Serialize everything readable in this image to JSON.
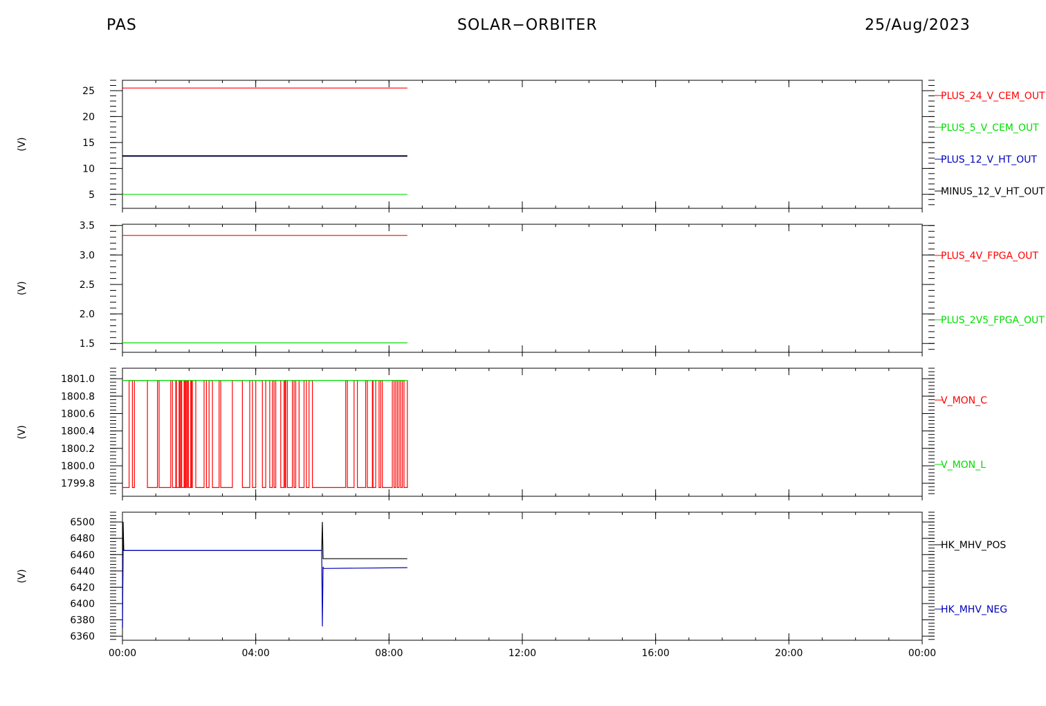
{
  "header": {
    "left": "PAS",
    "center": "SOLAR−ORBITER",
    "right": "25/Aug/2023"
  },
  "colors": {
    "red": "#ff0000",
    "green": "#00dd00",
    "blue": "#0000bb",
    "black": "#000000"
  },
  "chart_data": [
    {
      "type": "line",
      "ylabel": "(V)",
      "ylim": [
        2.3,
        27.0
      ],
      "yticks": [
        5,
        10,
        15,
        20,
        25
      ],
      "yticklabels": [
        "5",
        "10",
        "15",
        "20",
        "25"
      ],
      "xlim": [
        0,
        24
      ],
      "series": [
        {
          "name": "PLUS_24_V_CEM_OUT",
          "color": "red",
          "x": [
            0,
            8.55
          ],
          "y": [
            25.5,
            25.5
          ]
        },
        {
          "name": "PLUS_5_V_CEM_OUT",
          "color": "green",
          "x": [
            0,
            8.55
          ],
          "y": [
            5.0,
            5.0
          ]
        },
        {
          "name": "PLUS_12_V_HT_OUT",
          "color": "blue",
          "x": [
            0,
            8.55
          ],
          "y": [
            12.4,
            12.4
          ]
        },
        {
          "name": "MINUS_12_V_HT_OUT",
          "color": "black",
          "x": [
            0,
            8.55
          ],
          "y": [
            12.4,
            12.4
          ]
        }
      ]
    },
    {
      "type": "line",
      "ylabel": "(V)",
      "ylim": [
        1.35,
        3.52
      ],
      "yticks": [
        1.5,
        2.0,
        2.5,
        3.0,
        3.5
      ],
      "yticklabels": [
        "1.5",
        "2.0",
        "2.5",
        "3.0",
        "3.5"
      ],
      "xlim": [
        0,
        24
      ],
      "series": [
        {
          "name": "PLUS_4V_FPGA_OUT",
          "color": "red",
          "x": [
            0,
            8.55
          ],
          "y": [
            3.33,
            3.33
          ]
        },
        {
          "name": "PLUS_2V5_FPGA_OUT",
          "color": "green",
          "x": [
            0,
            8.55
          ],
          "y": [
            1.51,
            1.51
          ]
        }
      ]
    },
    {
      "type": "line",
      "ylabel": "(V)",
      "ylim": [
        1799.65,
        1801.12
      ],
      "yticks": [
        1799.8,
        1800.0,
        1800.2,
        1800.4,
        1800.6,
        1800.8,
        1801.0
      ],
      "yticklabels": [
        "1799.8",
        "1800.0",
        "1800.2",
        "1800.4",
        "1800.6",
        "1800.8",
        "1801.0"
      ],
      "xlim": [
        0,
        24
      ],
      "series": [
        {
          "name": "V_MON_C",
          "color": "red",
          "low": 1799.75,
          "high": 1800.98,
          "x_start": 0,
          "x_end": 8.55,
          "toggles_x": [
            0.2,
            0.3,
            0.36,
            0.75,
            1.05,
            1.1,
            1.45,
            1.5,
            1.6,
            1.62,
            1.7,
            1.72,
            1.75,
            1.78,
            1.85,
            1.87,
            1.9,
            1.93,
            1.95,
            1.98,
            2.05,
            2.07,
            2.1,
            2.2,
            2.45,
            2.52,
            2.6,
            2.7,
            2.9,
            2.95,
            3.3,
            3.6,
            3.82,
            3.9,
            4.0,
            4.2,
            4.3,
            4.42,
            4.5,
            4.55,
            4.6,
            4.75,
            4.85,
            4.88,
            4.9,
            4.95,
            5.1,
            5.15,
            5.2,
            5.3,
            5.45,
            5.52,
            5.6,
            5.7,
            6.7,
            6.75,
            6.95,
            7.05,
            7.3,
            7.35,
            7.5,
            7.52,
            7.6,
            7.7,
            7.75,
            7.8,
            8.1,
            8.15,
            8.2,
            8.25,
            8.3,
            8.35,
            8.4,
            8.45,
            8.55
          ]
        },
        {
          "name": "V_MON_L",
          "color": "green",
          "x": [
            0,
            8.55
          ],
          "y": [
            1800.98,
            1800.98
          ]
        }
      ]
    },
    {
      "type": "line",
      "ylabel": "(V)",
      "ylim": [
        6355,
        6512
      ],
      "yticks": [
        6360,
        6380,
        6400,
        6420,
        6440,
        6460,
        6480,
        6500
      ],
      "yticklabels": [
        "6360",
        "6380",
        "6400",
        "6420",
        "6440",
        "6460",
        "6480",
        "6500"
      ],
      "xlim": [
        0,
        24
      ],
      "series": [
        {
          "name": "HK_MHV_POS",
          "color": "black",
          "x": [
            0,
            0.02,
            0.04,
            0.06,
            5.98,
            6.0,
            6.02,
            6.04,
            6.08,
            8.55
          ],
          "y": [
            6370,
            6500,
            6465,
            6465,
            6465,
            6500,
            6455,
            6455,
            6455,
            6455
          ]
        },
        {
          "name": "HK_MHV_NEG",
          "color": "blue",
          "x": [
            0,
            0.02,
            0.04,
            0.06,
            5.98,
            6.0,
            6.02,
            6.04,
            6.08,
            8.55
          ],
          "y": [
            6370,
            6465,
            6465,
            6465,
            6465,
            6372,
            6445,
            6443,
            6443,
            6444
          ]
        }
      ]
    }
  ],
  "xaxis": {
    "range_hours": [
      0,
      24
    ],
    "ticks_hours": [
      0,
      4,
      8,
      12,
      16,
      20,
      24
    ],
    "tick_labels": [
      "00:00",
      "04:00",
      "08:00",
      "12:00",
      "16:00",
      "20:00",
      "00:00"
    ],
    "minor_step_hours": 1
  }
}
